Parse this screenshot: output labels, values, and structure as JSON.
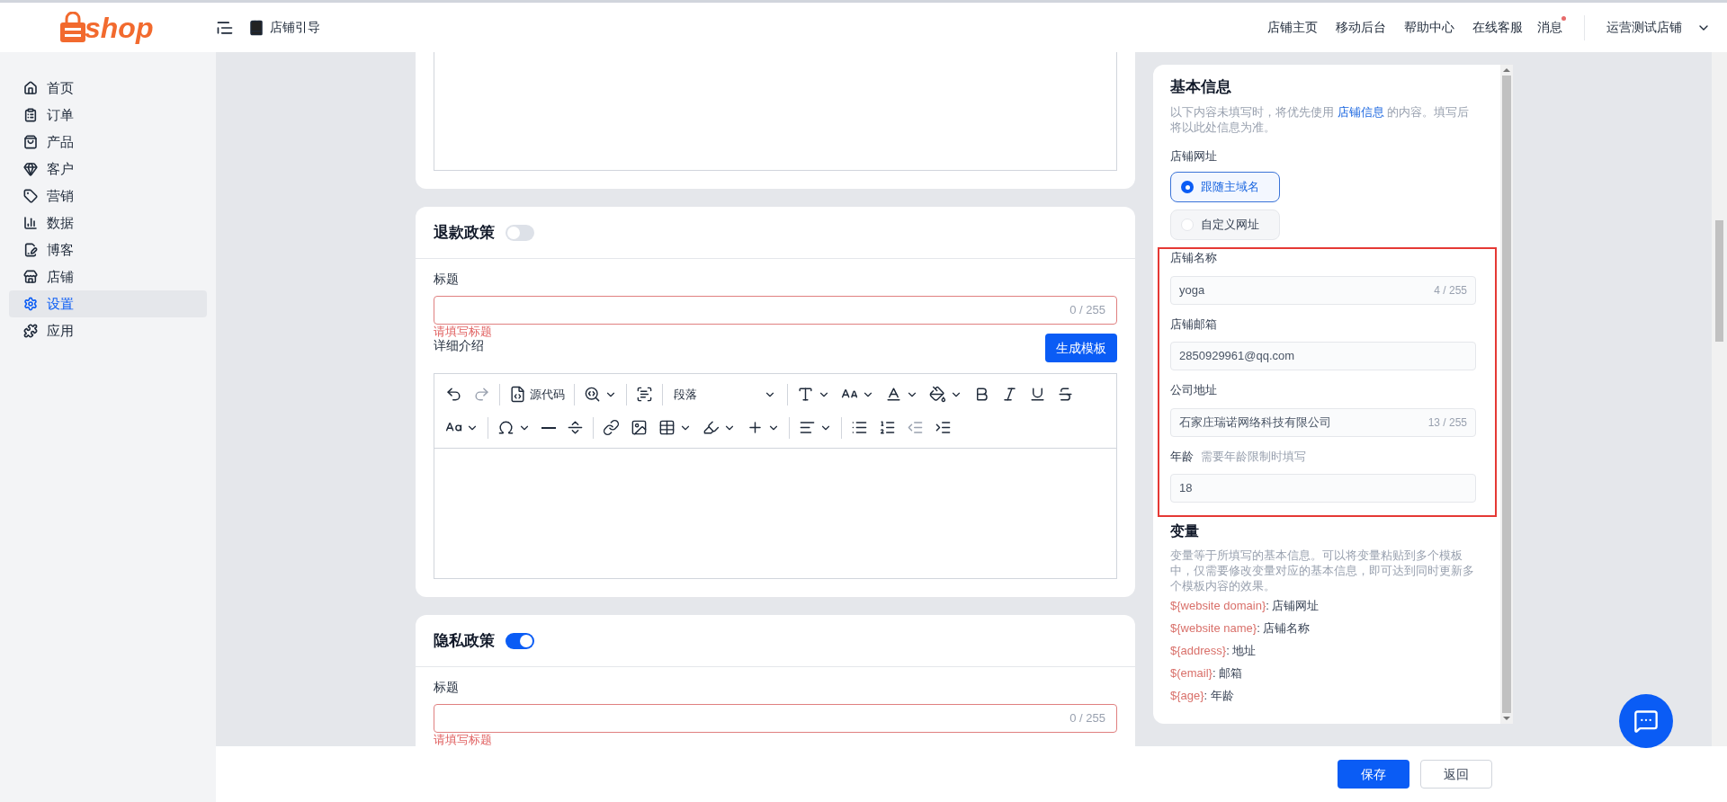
{
  "header": {
    "logo": "shop",
    "guide": "店铺引导",
    "links": [
      "店铺主页",
      "移动后台",
      "帮助中心",
      "在线客服"
    ],
    "messages": {
      "label": "消息",
      "unread": true
    },
    "store": "运营测试店铺"
  },
  "sidebar": {
    "items": [
      {
        "label": "首页",
        "selected": false
      },
      {
        "label": "订单",
        "selected": false
      },
      {
        "label": "产品",
        "selected": false
      },
      {
        "label": "客户",
        "selected": false
      },
      {
        "label": "营销",
        "selected": false
      },
      {
        "label": "数据",
        "selected": false
      },
      {
        "label": "博客",
        "selected": false
      },
      {
        "label": "店铺",
        "selected": false
      },
      {
        "label": "设置",
        "selected": true
      },
      {
        "label": "应用",
        "selected": false
      }
    ]
  },
  "policies": [
    {
      "title": "退款政策",
      "enabled": false,
      "field_label": "标题",
      "count": "0 / 255",
      "error": "请填写标题",
      "detail_label": "详细介绍",
      "template_button": "生成模板",
      "editor": {
        "source_label": "源代码",
        "block_format": "段落"
      }
    },
    {
      "title": "隐私政策",
      "enabled": true,
      "field_label": "标题",
      "count": "0 / 255",
      "error": "请填写标题"
    }
  ],
  "basic_info": {
    "title": "基本信息",
    "description_start": "以下内容未填写时，将优先使用 ",
    "description_link": "店铺信息",
    "description_end": " 的内容。填写后将以此处信息为准。",
    "url_label": "店铺网址",
    "url_options": [
      {
        "label": "跟随主域名",
        "selected": true
      },
      {
        "label": "自定义网址",
        "selected": false
      }
    ],
    "fields": [
      {
        "label": "店铺名称",
        "value": "yoga",
        "count": "4 / 255"
      },
      {
        "label": "店铺邮箱",
        "value": "2850929961@qq.com"
      },
      {
        "label": "公司地址",
        "value": "石家庄瑞诺网络科技有限公司",
        "count": "13 / 255"
      },
      {
        "label": "年龄",
        "hint": "需要年龄限制时填写",
        "value": "18"
      }
    ]
  },
  "variables": {
    "title": "变量",
    "description": "变量等于所填写的基本信息。可以将变量粘贴到多个模板中，仅需要修改变量对应的基本信息，即可达到同时更新多个模板内容的效果。",
    "items": [
      {
        "name": "${website domain}",
        "meaning": ": 店铺网址"
      },
      {
        "name": "${website name}",
        "meaning": ": 店铺名称"
      },
      {
        "name": "${address}",
        "meaning": ": 地址"
      },
      {
        "name": "$(email}",
        "meaning": ": 邮箱"
      },
      {
        "name": "${age}",
        "meaning": ": 年龄"
      }
    ]
  },
  "footer": {
    "save": "保存",
    "back": "返回"
  }
}
